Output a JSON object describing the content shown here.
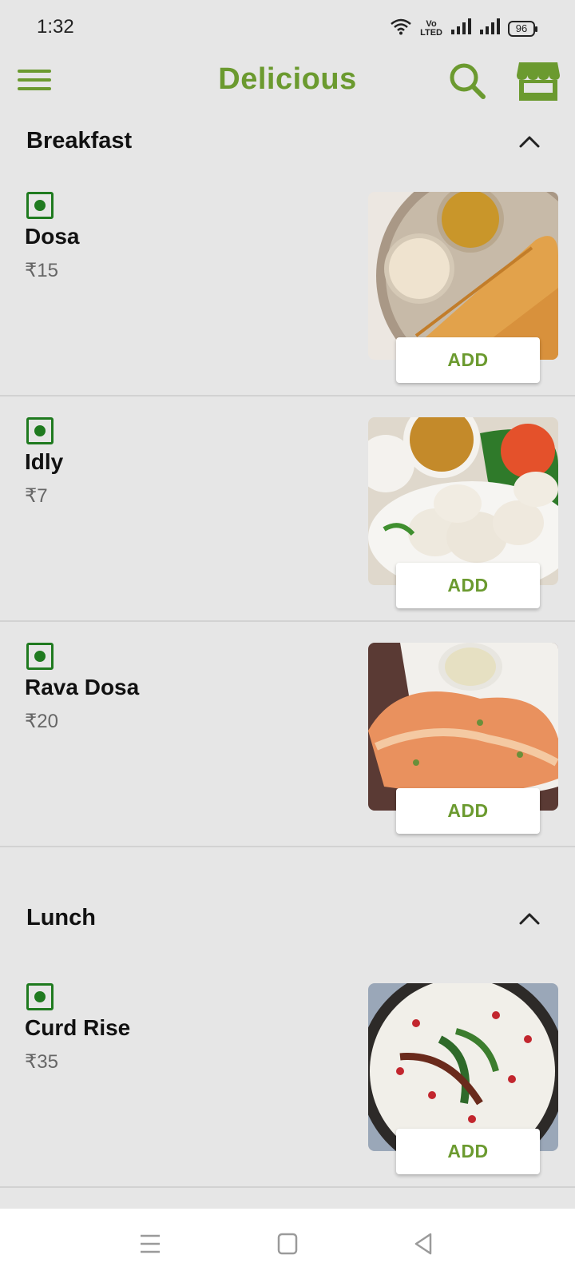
{
  "status_bar": {
    "time": "1:32",
    "volte_top": "Vo",
    "volte_bottom": "LTED",
    "battery": "96"
  },
  "app_bar": {
    "title": "Delicious"
  },
  "sections": [
    {
      "title": "Breakfast",
      "items": [
        {
          "name": "Dosa",
          "price": "₹15",
          "add_label": "ADD"
        },
        {
          "name": "Idly",
          "price": "₹7",
          "add_label": "ADD"
        },
        {
          "name": "Rava Dosa",
          "price": "₹20",
          "add_label": "ADD"
        }
      ]
    },
    {
      "title": "Lunch",
      "items": [
        {
          "name": "Curd Rise",
          "price": "₹35",
          "add_label": "ADD"
        }
      ]
    }
  ],
  "colors": {
    "brand": "#6b9a2f",
    "veg": "#1f7a1f",
    "background": "#e6e6e6"
  }
}
